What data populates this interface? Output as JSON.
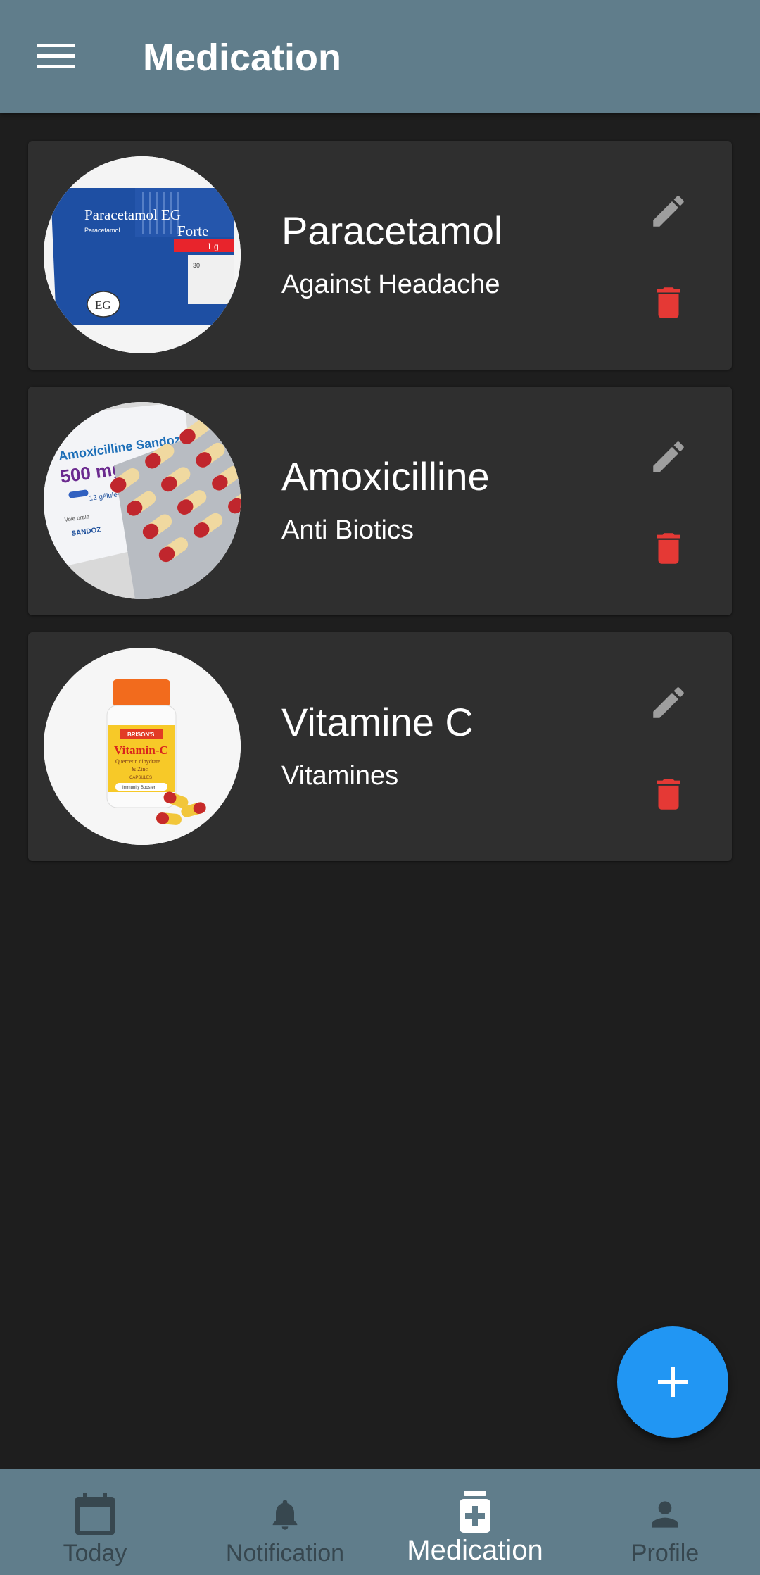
{
  "appbar": {
    "title": "Medication",
    "menu_icon": "hamburger-menu-icon"
  },
  "medications": [
    {
      "name": "Paracetamol",
      "description": "Against Headache",
      "image_text": [
        "Paracetamol EG",
        "Forte",
        "Paracetamol",
        "1 g",
        "EG",
        "30"
      ]
    },
    {
      "name": "Amoxicilline",
      "description": "Anti Biotics",
      "image_text": [
        "Amoxicilline Sandoz",
        "500 mg",
        "12 gélules",
        "Voie orale",
        "SANDOZ"
      ]
    },
    {
      "name": "Vitamine C",
      "description": "Vitamines",
      "image_text": [
        "BRISON'S",
        "Vitamin-C",
        "Quercetin dihydrate",
        "& Zinc",
        "CAPSULES",
        "Immunity Booster"
      ]
    }
  ],
  "actions": {
    "edit_icon": "pencil-icon",
    "delete_icon": "trash-icon",
    "edit_color": "#9e9e9e",
    "delete_color": "#e53935"
  },
  "fab": {
    "icon": "plus-icon",
    "color": "#2196f3"
  },
  "bottom_nav": {
    "items": [
      {
        "label": "Today",
        "icon": "calendar-icon",
        "active": false
      },
      {
        "label": "Notification",
        "icon": "bell-icon",
        "active": false
      },
      {
        "label": "Medication",
        "icon": "medicine-bottle-icon",
        "active": true
      },
      {
        "label": "Profile",
        "icon": "person-icon",
        "active": false
      }
    ]
  },
  "colors": {
    "appbar": "#607d8b",
    "background": "#1e1e1e",
    "card": "#2f2f2f",
    "nav_inactive_text": "#37474f"
  }
}
